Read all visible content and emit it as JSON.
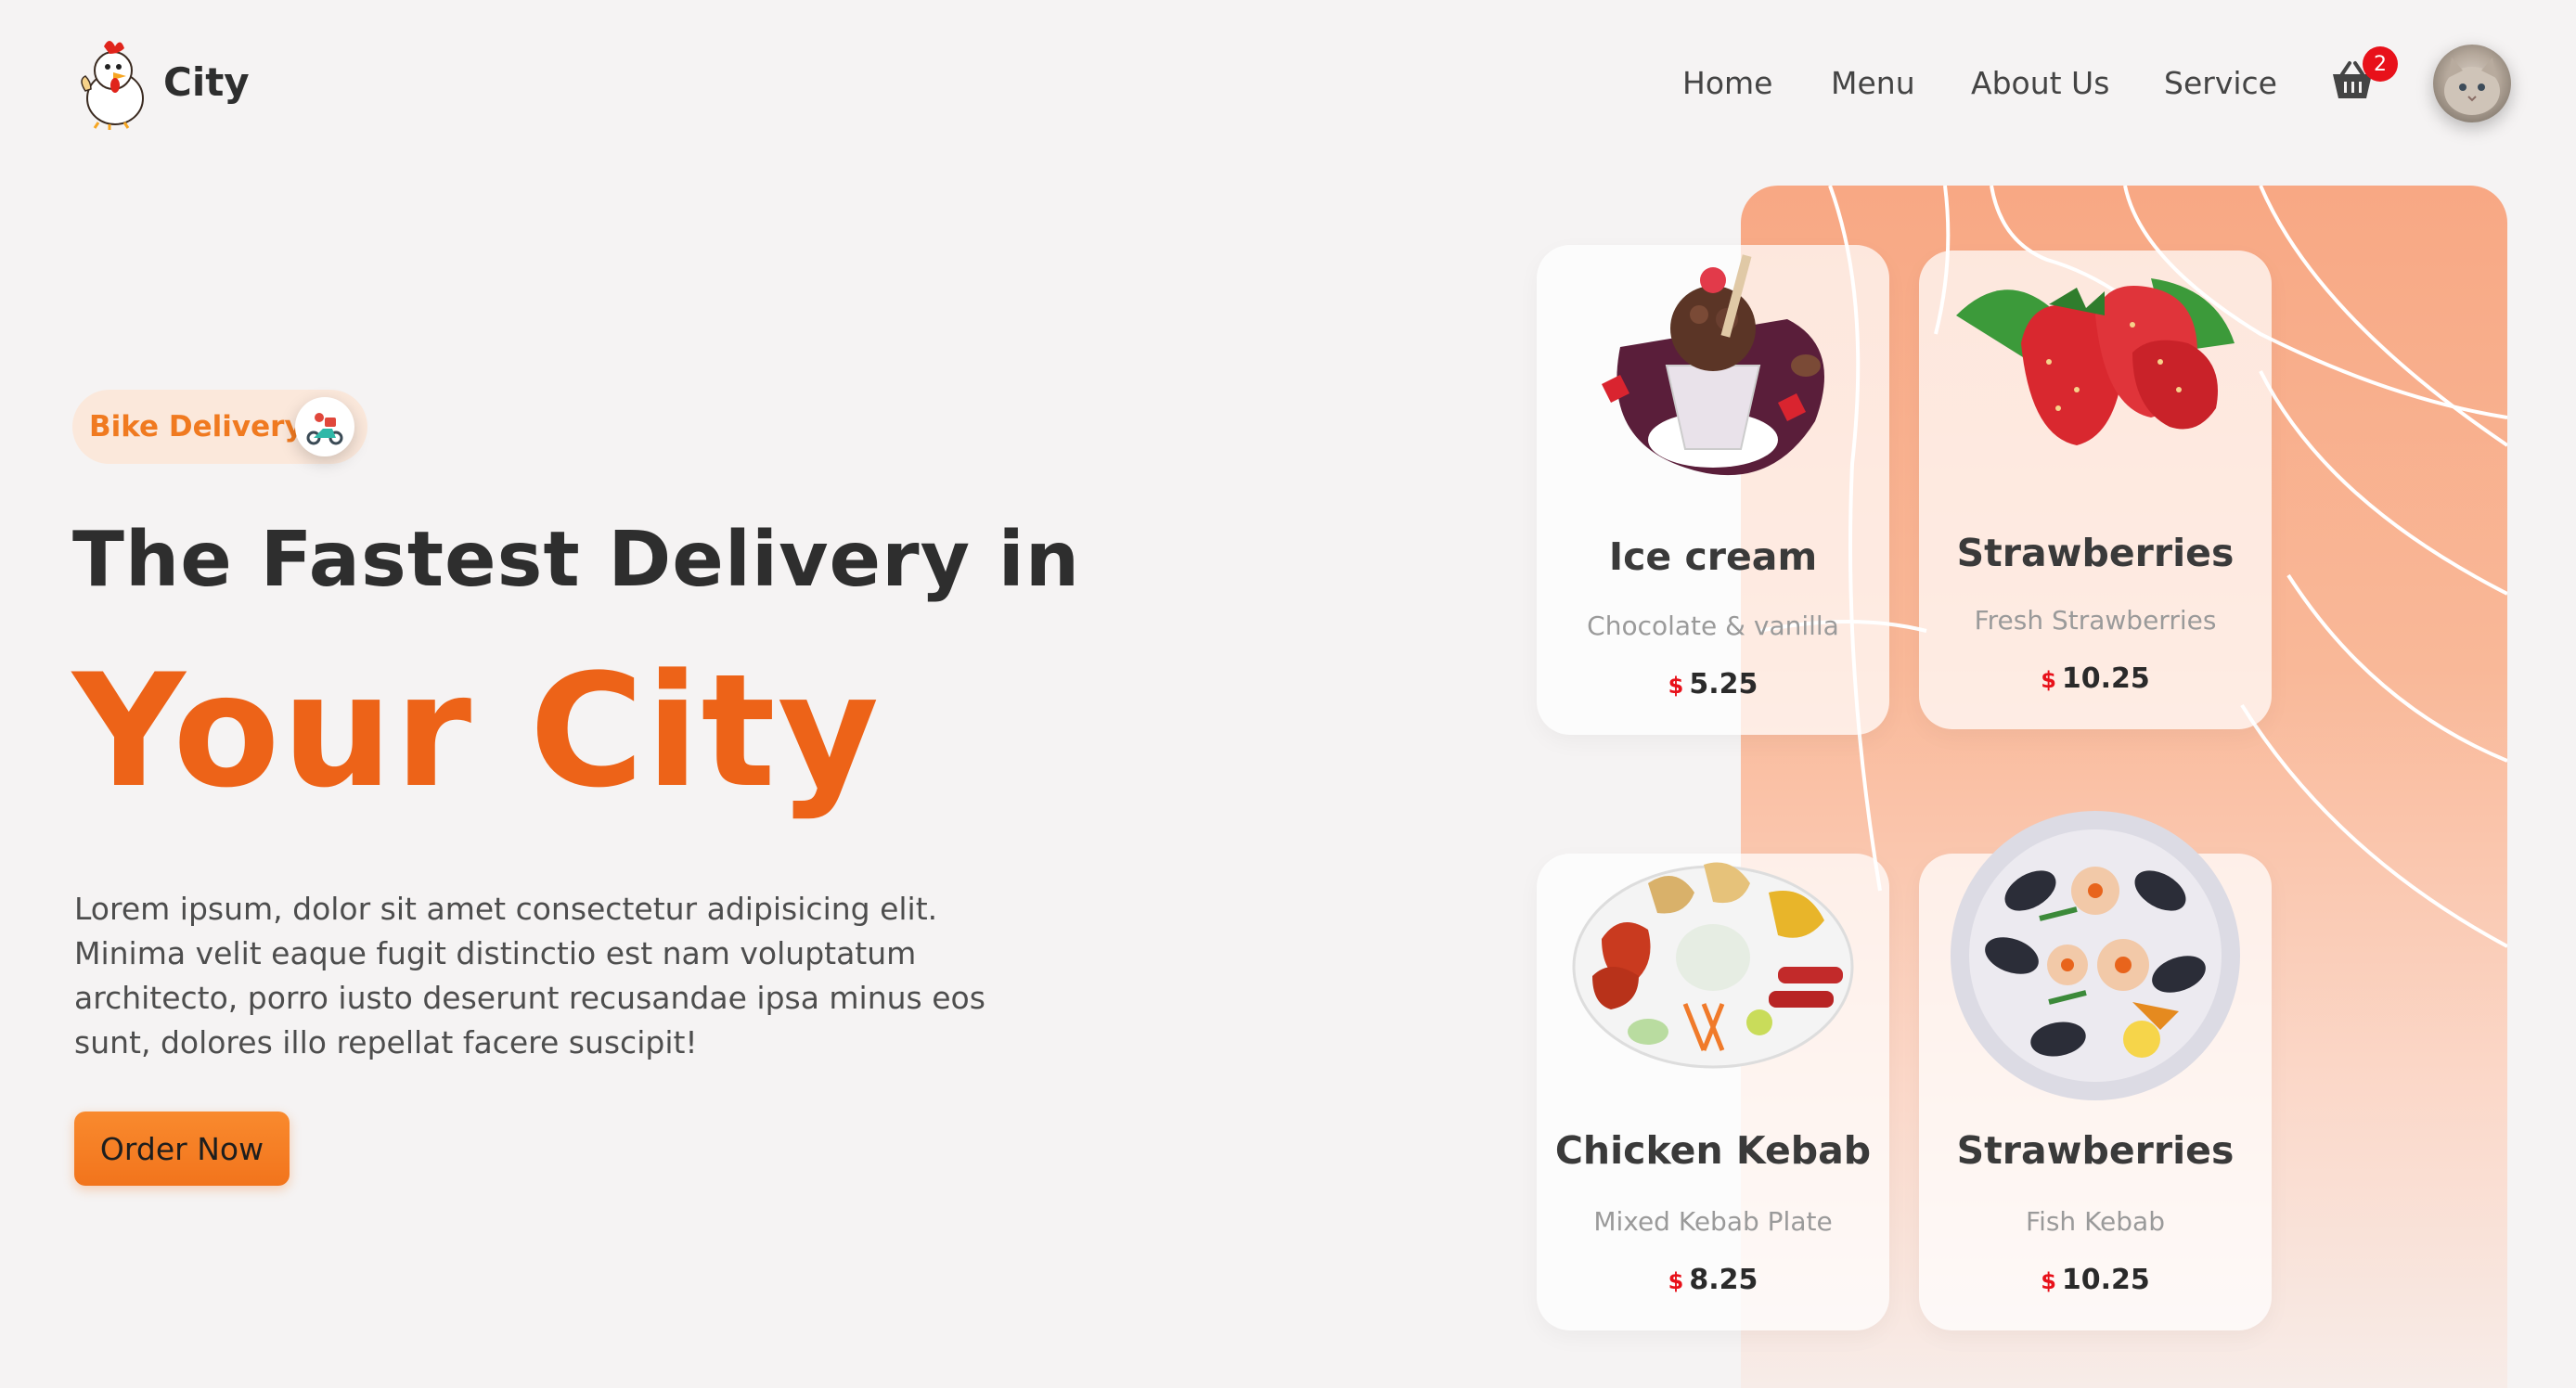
{
  "brand": {
    "name": "City"
  },
  "nav": {
    "items": [
      {
        "label": "Home"
      },
      {
        "label": "Menu"
      },
      {
        "label": "About Us"
      },
      {
        "label": "Service"
      }
    ],
    "cart_count": "2"
  },
  "hero": {
    "badge": "Bike Delivery",
    "title": "The Fastest Delivery in",
    "highlight": "Your City",
    "description": "Lorem ipsum, dolor sit amet consectetur adipisicing elit. Minima velit eaque fugit distinctio est nam voluptatum architecto, porro iusto deserunt recusandae ipsa minus eos sunt, dolores illo repellat facere suscipit!",
    "cta": "Order Now"
  },
  "cards": [
    {
      "title": "Ice cream",
      "subtitle": "Chocolate & vanilla",
      "currency": "$",
      "price": "5.25",
      "image": "ice-cream-image"
    },
    {
      "title": "Strawberries",
      "subtitle": "Fresh Strawberries",
      "currency": "$",
      "price": "10.25",
      "image": "strawberries-image"
    },
    {
      "title": "Chicken Kebab",
      "subtitle": "Mixed Kebab Plate",
      "currency": "$",
      "price": "8.25",
      "image": "kebab-plate-image"
    },
    {
      "title": "Strawberries",
      "subtitle": "Fish Kebab",
      "currency": "$",
      "price": "10.25",
      "image": "seafood-plate-image"
    }
  ],
  "colors": {
    "accent": "#ed6318",
    "button": "#f2741c",
    "badge_bg": "#fbe8db",
    "price_currency": "#e8111a",
    "panel": "#f8a884"
  },
  "icons": [
    "chicken-logo-icon",
    "cart-icon",
    "scooter-icon",
    "avatar-image"
  ]
}
